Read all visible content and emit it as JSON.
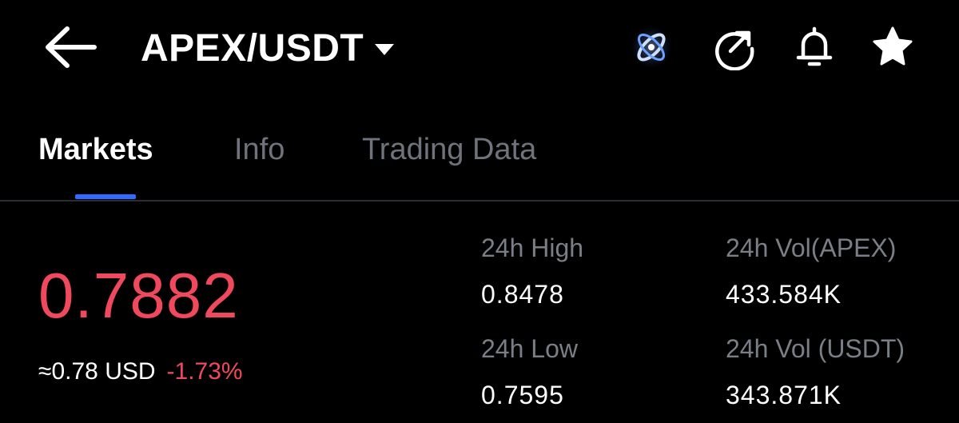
{
  "header": {
    "back_icon": "arrow-left-icon",
    "pair": "APEX/USDT",
    "caret_icon": "caret-down-icon",
    "icons": [
      "satellite-badge-icon",
      "share-icon",
      "bell-icon",
      "star-icon"
    ]
  },
  "tabs": [
    {
      "label": "Markets",
      "active": true
    },
    {
      "label": "Info",
      "active": false
    },
    {
      "label": "Trading Data",
      "active": false
    }
  ],
  "ticker": {
    "last_price": "0.7882",
    "usd_approx": "≈0.78 USD",
    "change": "-1.73%"
  },
  "stats": {
    "high_label": "24h High",
    "high_value": "0.8478",
    "low_label": "24h Low",
    "low_value": "0.7595",
    "vol_base_label": "24h Vol(APEX)",
    "vol_base_value": "433.584K",
    "vol_quote_label": "24h Vol (USDT)",
    "vol_quote_value": "343.871K"
  },
  "colors": {
    "background": "#000000",
    "down": "#f0495e",
    "accent": "#2f6bff",
    "muted": "#7a7f87"
  }
}
